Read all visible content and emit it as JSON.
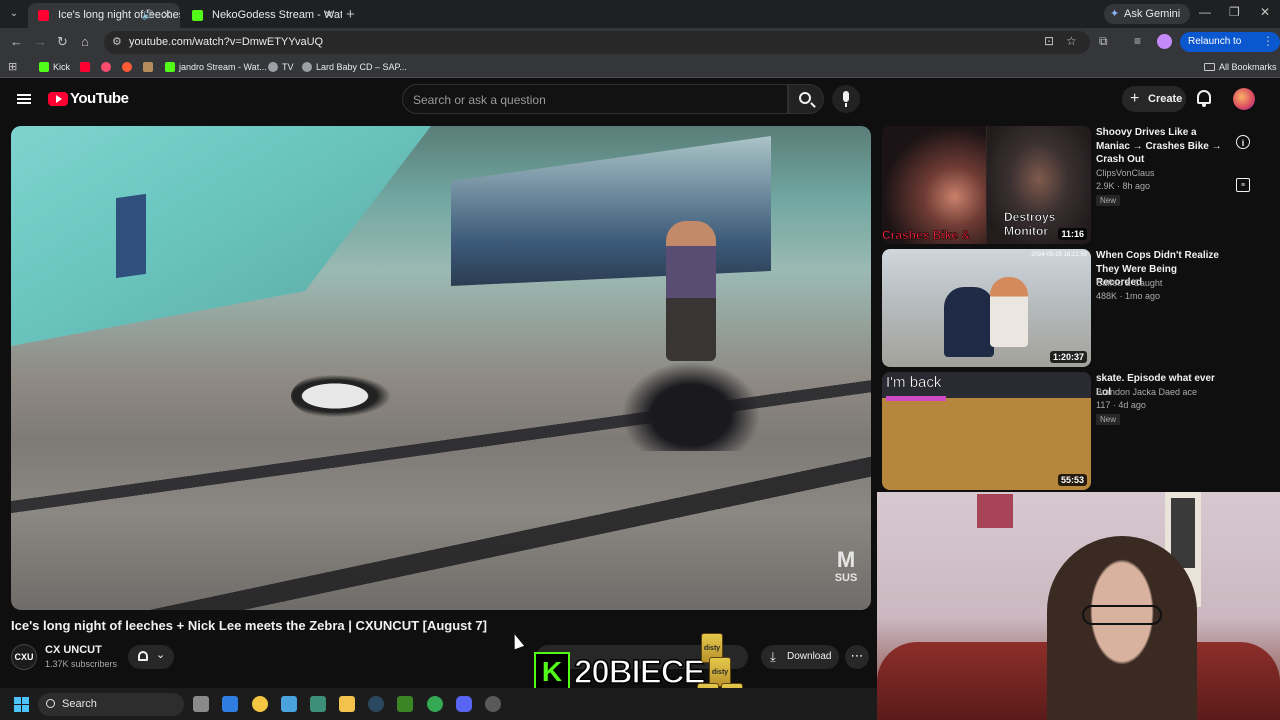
{
  "browser": {
    "tabs": [
      {
        "title": "Ice's long night of leeches",
        "active": true,
        "favicon_color": "#ff0033"
      },
      {
        "title": "NekoGodess Stream - Watch Li",
        "active": false,
        "favicon_color": "#53fc18"
      }
    ],
    "gemini_label": "Ask Gemini",
    "url": "youtube.com/watch?v=DmwETYYvaUQ",
    "relaunch_label": "Relaunch to update",
    "bookmarks": [
      {
        "label": "Kick",
        "color": "#53fc18"
      },
      {
        "label": "",
        "color": "#ff0033"
      },
      {
        "label": "",
        "color": "#ff4d6d"
      },
      {
        "label": "",
        "color": "#ff5a36"
      },
      {
        "label": "",
        "color": "#b58b5c"
      },
      {
        "label": "jandro Stream - Wat...",
        "color": "#53fc18"
      },
      {
        "label": "TV",
        "color": "#9aa0a6"
      },
      {
        "label": "Lard Baby CD – SAP...",
        "color": "#9aa0a6"
      }
    ],
    "all_bookmarks_label": "All Bookmarks"
  },
  "youtube": {
    "logo_text": "YouTube",
    "search_placeholder": "Search or ask a question",
    "create_label": "Create"
  },
  "video": {
    "title": "Ice's long night of leeches + Nick Lee meets the Zebra | CXUNCUT [August 7]",
    "channel_name": "CX UNCUT",
    "channel_avatar_text": "CXU",
    "subscribers": "1.37K subscribers",
    "download_label": "Download",
    "watermark": "SUS",
    "overlay_text": "20BIECE",
    "overlay_k": "K",
    "can_label": "disty"
  },
  "recommendations": [
    {
      "title": "Shoovy Drives Like a Maniac → Crashes Bike → Crash Out",
      "channel": "ClipsVonClaus",
      "meta": "2.9K · 8h ago",
      "badge": "New",
      "duration": "11:16",
      "thumb_caption_left": "Crashes Bike &",
      "thumb_caption_right": "Destroys Monitor"
    },
    {
      "title": "When Cops Didn't Realize They Were Being Recorded",
      "channel": "Cuffed & Caught",
      "meta": "488K · 1mo ago",
      "duration": "1:20:37",
      "thumb_stamp": "2024-05-25 16:21:59"
    },
    {
      "title": "skate. Episode what ever Lol",
      "channel": "Brandon Jacka Daed ace",
      "meta": "117 · 4d ago",
      "badge": "New",
      "duration": "55:53",
      "thumb_caption": "I'm back"
    }
  ],
  "taskbar": {
    "search_label": "Search",
    "apps": [
      {
        "name": "task-view",
        "color": "#8a8a8a"
      },
      {
        "name": "widgets",
        "color": "#2f7de1"
      },
      {
        "name": "edge",
        "color": "#f4c542"
      },
      {
        "name": "photos",
        "color": "#4aa3df"
      },
      {
        "name": "calculator",
        "color": "#3d8f7a"
      },
      {
        "name": "file-explorer",
        "color": "#f2c14e"
      },
      {
        "name": "steam",
        "color": "#2a475e"
      },
      {
        "name": "minecraft",
        "color": "#3c8527"
      },
      {
        "name": "chrome",
        "color": "#34a853"
      },
      {
        "name": "discord",
        "color": "#5865f2"
      },
      {
        "name": "obs",
        "color": "#5a5a5a"
      }
    ]
  }
}
